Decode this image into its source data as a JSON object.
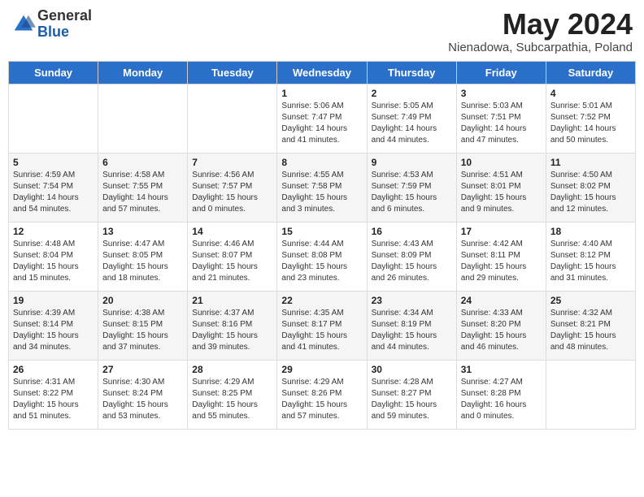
{
  "header": {
    "logo_general": "General",
    "logo_blue": "Blue",
    "month_title": "May 2024",
    "subtitle": "Nienadowa, Subcarpathia, Poland"
  },
  "days_of_week": [
    "Sunday",
    "Monday",
    "Tuesday",
    "Wednesday",
    "Thursday",
    "Friday",
    "Saturday"
  ],
  "weeks": [
    [
      {
        "day": "",
        "sunrise": "",
        "sunset": "",
        "daylight": ""
      },
      {
        "day": "",
        "sunrise": "",
        "sunset": "",
        "daylight": ""
      },
      {
        "day": "",
        "sunrise": "",
        "sunset": "",
        "daylight": ""
      },
      {
        "day": "1",
        "sunrise": "Sunrise: 5:06 AM",
        "sunset": "Sunset: 7:47 PM",
        "daylight": "Daylight: 14 hours and 41 minutes."
      },
      {
        "day": "2",
        "sunrise": "Sunrise: 5:05 AM",
        "sunset": "Sunset: 7:49 PM",
        "daylight": "Daylight: 14 hours and 44 minutes."
      },
      {
        "day": "3",
        "sunrise": "Sunrise: 5:03 AM",
        "sunset": "Sunset: 7:51 PM",
        "daylight": "Daylight: 14 hours and 47 minutes."
      },
      {
        "day": "4",
        "sunrise": "Sunrise: 5:01 AM",
        "sunset": "Sunset: 7:52 PM",
        "daylight": "Daylight: 14 hours and 50 minutes."
      }
    ],
    [
      {
        "day": "5",
        "sunrise": "Sunrise: 4:59 AM",
        "sunset": "Sunset: 7:54 PM",
        "daylight": "Daylight: 14 hours and 54 minutes."
      },
      {
        "day": "6",
        "sunrise": "Sunrise: 4:58 AM",
        "sunset": "Sunset: 7:55 PM",
        "daylight": "Daylight: 14 hours and 57 minutes."
      },
      {
        "day": "7",
        "sunrise": "Sunrise: 4:56 AM",
        "sunset": "Sunset: 7:57 PM",
        "daylight": "Daylight: 15 hours and 0 minutes."
      },
      {
        "day": "8",
        "sunrise": "Sunrise: 4:55 AM",
        "sunset": "Sunset: 7:58 PM",
        "daylight": "Daylight: 15 hours and 3 minutes."
      },
      {
        "day": "9",
        "sunrise": "Sunrise: 4:53 AM",
        "sunset": "Sunset: 7:59 PM",
        "daylight": "Daylight: 15 hours and 6 minutes."
      },
      {
        "day": "10",
        "sunrise": "Sunrise: 4:51 AM",
        "sunset": "Sunset: 8:01 PM",
        "daylight": "Daylight: 15 hours and 9 minutes."
      },
      {
        "day": "11",
        "sunrise": "Sunrise: 4:50 AM",
        "sunset": "Sunset: 8:02 PM",
        "daylight": "Daylight: 15 hours and 12 minutes."
      }
    ],
    [
      {
        "day": "12",
        "sunrise": "Sunrise: 4:48 AM",
        "sunset": "Sunset: 8:04 PM",
        "daylight": "Daylight: 15 hours and 15 minutes."
      },
      {
        "day": "13",
        "sunrise": "Sunrise: 4:47 AM",
        "sunset": "Sunset: 8:05 PM",
        "daylight": "Daylight: 15 hours and 18 minutes."
      },
      {
        "day": "14",
        "sunrise": "Sunrise: 4:46 AM",
        "sunset": "Sunset: 8:07 PM",
        "daylight": "Daylight: 15 hours and 21 minutes."
      },
      {
        "day": "15",
        "sunrise": "Sunrise: 4:44 AM",
        "sunset": "Sunset: 8:08 PM",
        "daylight": "Daylight: 15 hours and 23 minutes."
      },
      {
        "day": "16",
        "sunrise": "Sunrise: 4:43 AM",
        "sunset": "Sunset: 8:09 PM",
        "daylight": "Daylight: 15 hours and 26 minutes."
      },
      {
        "day": "17",
        "sunrise": "Sunrise: 4:42 AM",
        "sunset": "Sunset: 8:11 PM",
        "daylight": "Daylight: 15 hours and 29 minutes."
      },
      {
        "day": "18",
        "sunrise": "Sunrise: 4:40 AM",
        "sunset": "Sunset: 8:12 PM",
        "daylight": "Daylight: 15 hours and 31 minutes."
      }
    ],
    [
      {
        "day": "19",
        "sunrise": "Sunrise: 4:39 AM",
        "sunset": "Sunset: 8:14 PM",
        "daylight": "Daylight: 15 hours and 34 minutes."
      },
      {
        "day": "20",
        "sunrise": "Sunrise: 4:38 AM",
        "sunset": "Sunset: 8:15 PM",
        "daylight": "Daylight: 15 hours and 37 minutes."
      },
      {
        "day": "21",
        "sunrise": "Sunrise: 4:37 AM",
        "sunset": "Sunset: 8:16 PM",
        "daylight": "Daylight: 15 hours and 39 minutes."
      },
      {
        "day": "22",
        "sunrise": "Sunrise: 4:35 AM",
        "sunset": "Sunset: 8:17 PM",
        "daylight": "Daylight: 15 hours and 41 minutes."
      },
      {
        "day": "23",
        "sunrise": "Sunrise: 4:34 AM",
        "sunset": "Sunset: 8:19 PM",
        "daylight": "Daylight: 15 hours and 44 minutes."
      },
      {
        "day": "24",
        "sunrise": "Sunrise: 4:33 AM",
        "sunset": "Sunset: 8:20 PM",
        "daylight": "Daylight: 15 hours and 46 minutes."
      },
      {
        "day": "25",
        "sunrise": "Sunrise: 4:32 AM",
        "sunset": "Sunset: 8:21 PM",
        "daylight": "Daylight: 15 hours and 48 minutes."
      }
    ],
    [
      {
        "day": "26",
        "sunrise": "Sunrise: 4:31 AM",
        "sunset": "Sunset: 8:22 PM",
        "daylight": "Daylight: 15 hours and 51 minutes."
      },
      {
        "day": "27",
        "sunrise": "Sunrise: 4:30 AM",
        "sunset": "Sunset: 8:24 PM",
        "daylight": "Daylight: 15 hours and 53 minutes."
      },
      {
        "day": "28",
        "sunrise": "Sunrise: 4:29 AM",
        "sunset": "Sunset: 8:25 PM",
        "daylight": "Daylight: 15 hours and 55 minutes."
      },
      {
        "day": "29",
        "sunrise": "Sunrise: 4:29 AM",
        "sunset": "Sunset: 8:26 PM",
        "daylight": "Daylight: 15 hours and 57 minutes."
      },
      {
        "day": "30",
        "sunrise": "Sunrise: 4:28 AM",
        "sunset": "Sunset: 8:27 PM",
        "daylight": "Daylight: 15 hours and 59 minutes."
      },
      {
        "day": "31",
        "sunrise": "Sunrise: 4:27 AM",
        "sunset": "Sunset: 8:28 PM",
        "daylight": "Daylight: 16 hours and 0 minutes."
      },
      {
        "day": "",
        "sunrise": "",
        "sunset": "",
        "daylight": ""
      }
    ]
  ]
}
